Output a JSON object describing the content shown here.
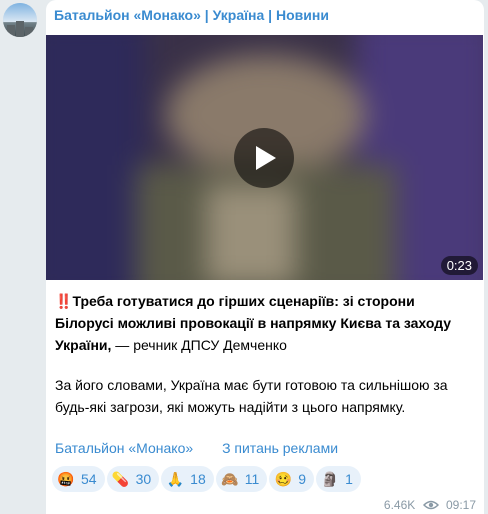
{
  "channel": {
    "title": "Батальйон «Монако» | Україна | Новини"
  },
  "video": {
    "duration": "0:23"
  },
  "post": {
    "emoji": "‼️",
    "headline": "Треба готуватися до гірших сценаріїв: зі сторони Білорусі можливі провокації в напрямку Києва та заходу України,",
    "attribution": " — речник ДПСУ Демченко",
    "body": "За його словами, Україна має бути готовою та сильнішою за будь-які загрози, які можуть надійти з цього напрямку."
  },
  "links": {
    "channel_link": "Батальйон «Монако»",
    "ads_link": "З питань реклами"
  },
  "reactions": [
    {
      "emoji": "🤬",
      "count": "54"
    },
    {
      "emoji": "💊",
      "count": "30"
    },
    {
      "emoji": "🙏",
      "count": "18"
    },
    {
      "emoji": "🙈",
      "count": "11"
    },
    {
      "emoji": "🥴",
      "count": "9"
    },
    {
      "emoji": "🗿",
      "count": "1"
    }
  ],
  "meta": {
    "views": "6.46K",
    "time": "09:17"
  },
  "colors": {
    "accent": "#3a8bd0",
    "bubble": "#ffffff",
    "background": "#e6ebee",
    "reaction_bg": "#e8f1fa"
  }
}
